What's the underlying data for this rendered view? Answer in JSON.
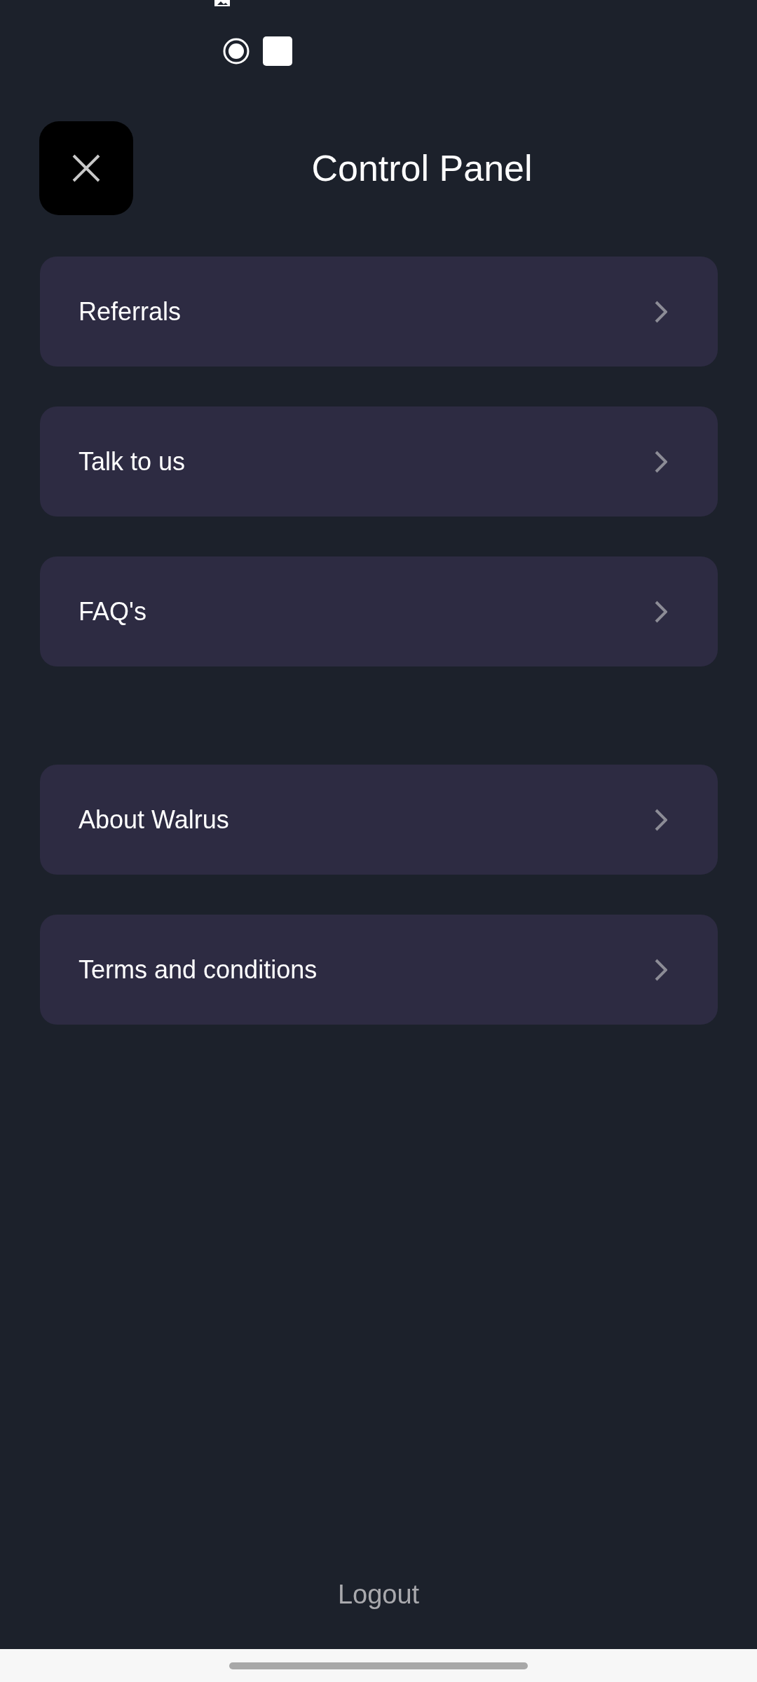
{
  "header": {
    "title": "Control Panel"
  },
  "menu_sections": [
    {
      "items": [
        {
          "label": "Referrals"
        },
        {
          "label": "Talk to us"
        },
        {
          "label": "FAQ's"
        }
      ]
    },
    {
      "items": [
        {
          "label": "About Walrus"
        },
        {
          "label": "Terms and conditions"
        }
      ]
    }
  ],
  "logout": {
    "label": "Logout"
  }
}
